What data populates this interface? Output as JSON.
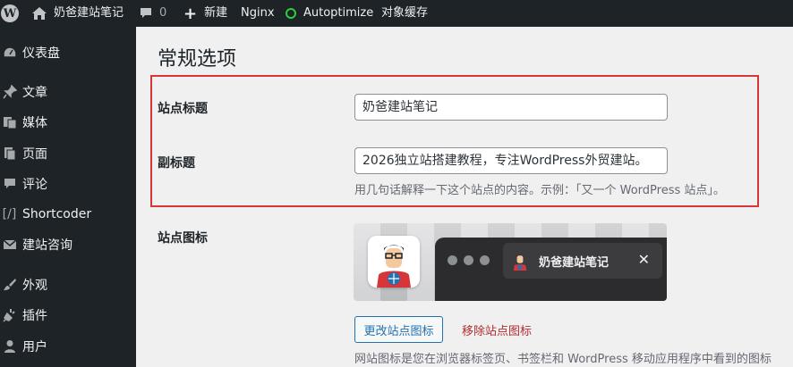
{
  "adminbar": {
    "wp_logo": "W",
    "site_name": "奶爸建站笔记",
    "comments_count": "0",
    "new_label": "新建",
    "nginx_label": "Nginx",
    "autoptimize_label": "Autoptimize",
    "object_cache_label": "对象缓存",
    "icons": {
      "home": "home-icon",
      "comment": "comment-icon",
      "plus": "plus-icon",
      "status": "status-ring-icon"
    },
    "status_color": "#28d13c"
  },
  "sidebar": {
    "items": [
      {
        "label": "仪表盘",
        "icon": "dashboard-icon"
      },
      {
        "label": "文章",
        "icon": "pin-icon"
      },
      {
        "label": "媒体",
        "icon": "media-icon"
      },
      {
        "label": "页面",
        "icon": "page-icon"
      },
      {
        "label": "评论",
        "icon": "comment-icon"
      },
      {
        "label": "Shortcoder",
        "icon": "shortcode-icon"
      },
      {
        "label": "建站咨询",
        "icon": "mail-icon"
      },
      {
        "label": "外观",
        "icon": "brush-icon"
      },
      {
        "label": "插件",
        "icon": "plugin-icon"
      },
      {
        "label": "用户",
        "icon": "user-icon"
      }
    ]
  },
  "main": {
    "page_title": "常规选项",
    "site_title_label": "站点标题",
    "site_title_value": "奶爸建站笔记",
    "tagline_label": "副标题",
    "tagline_value": "2026独立站搭建教程，专注WordPress外贸建站。",
    "tagline_desc": "用几句话解释一下这个站点的内容。示例：「又一个 WordPress 站点」。",
    "site_icon_label": "站点图标",
    "preview_tab_title": "奶爸建站笔记",
    "preview_close": "✕",
    "change_icon_button": "更改站点图标",
    "remove_icon_link": "移除站点图标",
    "site_icon_desc": "网站图标是您在浏览器标签页、书签栏和 WordPress 移动应用程序中看到的图标"
  },
  "colors": {
    "adminbar_bg": "#1d2327",
    "highlight_border": "#d63638",
    "link_blue": "#2271b1",
    "remove_red": "#b32d2e"
  }
}
